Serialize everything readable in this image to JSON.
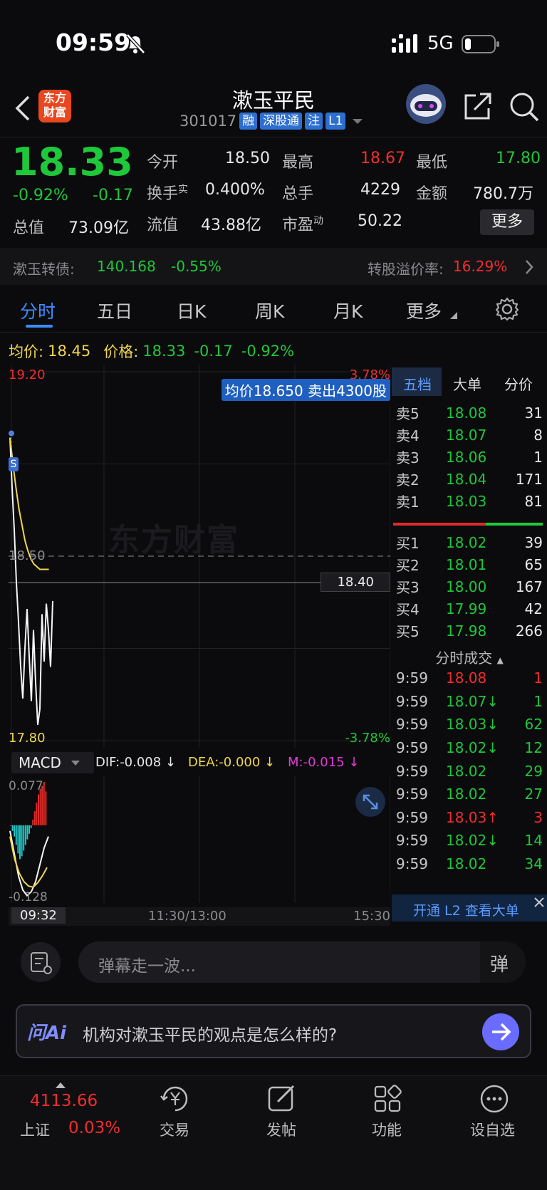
{
  "status_bar": {
    "time": "09:59",
    "network": "5G"
  },
  "header": {
    "title": "漱玉平民",
    "code": "301017",
    "badges": [
      "融",
      "深股通",
      "注",
      "L1"
    ],
    "logo_text": "东方\n财富"
  },
  "quote": {
    "price": "18.33",
    "change_pct": "-0.92%",
    "change": "-0.17",
    "open_label": "今开",
    "open": "18.50",
    "high_label": "最高",
    "high": "18.67",
    "low_label": "最低",
    "low": "17.80",
    "turnover_label": "换手",
    "turnover_sup": "实",
    "turnover": "0.400%",
    "volume_label": "总手",
    "volume": "4229",
    "amount_label": "金额",
    "amount": "780.7万",
    "mktcap_label": "总值",
    "mktcap": "73.09亿",
    "float_label": "流值",
    "float": "43.88亿",
    "pe_label": "市盈",
    "pe_sup": "动",
    "pe": "50.22",
    "more_button": "更多"
  },
  "bond": {
    "label": "漱玉转债:",
    "price": "140.168",
    "change": "-0.55%",
    "premium_label": "转股溢价率:",
    "premium": "16.29%"
  },
  "tabs": [
    "分时",
    "五日",
    "日K",
    "周K",
    "月K",
    "更多"
  ],
  "chart_info": {
    "avg_label": "均价:",
    "avg": "18.45",
    "price_label": "价格:",
    "price": "18.33",
    "change": "-0.17",
    "pct": "-0.92%"
  },
  "chart_data": {
    "type": "line",
    "y_top": "19.20",
    "y_mid": "18.50",
    "y_bottom": "17.80",
    "pct_top": "3.78%",
    "pct_bottom": "-3.78%",
    "ylim": [
      17.8,
      19.2
    ],
    "price_series": [
      18.95,
      18.76,
      18.6,
      18.4,
      18.25,
      18.08,
      17.96,
      18.15,
      18.3,
      18.12,
      17.95,
      18.22,
      18.02,
      17.86,
      17.92,
      18.28,
      18.1,
      18.32,
      18.22,
      18.08,
      18.33
    ],
    "avg_series": [
      18.95,
      18.85,
      18.76,
      18.68,
      18.62,
      18.56,
      18.52,
      18.49,
      18.47,
      18.46,
      18.45,
      18.45,
      18.45,
      18.45
    ],
    "crosshair_value": "18.40",
    "tooltip": "均价18.650 卖出4300股",
    "x_labels": [
      "09:32",
      "11:30/13:00",
      "15:30"
    ],
    "macd": {
      "label": "MACD",
      "dif": "DIF:-0.008 ↓",
      "dea": "DEA:-0.000 ↓",
      "m": "M:-0.015 ↓",
      "top": "0.077",
      "bottom": "-0.128",
      "ylim": [
        -0.128,
        0.077
      ],
      "bars": [
        0.0,
        -0.01,
        -0.02,
        -0.035,
        -0.05,
        -0.06,
        -0.055,
        -0.045,
        -0.035,
        -0.025,
        -0.015,
        -0.005,
        0.01,
        0.025,
        0.04,
        0.055,
        0.065,
        0.07,
        0.077,
        0.06
      ],
      "dif_series": [
        -0.01,
        -0.05,
        -0.09,
        -0.115,
        -0.125,
        -0.118,
        -0.1,
        -0.07,
        -0.04,
        -0.02
      ],
      "dea_series": [
        -0.02,
        -0.06,
        -0.085,
        -0.1,
        -0.108,
        -0.11,
        -0.102,
        -0.09,
        -0.075
      ]
    }
  },
  "orderbook": {
    "tabs": [
      "五档",
      "大单",
      "分价"
    ],
    "asks": [
      {
        "label": "卖5",
        "price": "18.08",
        "vol": "31"
      },
      {
        "label": "卖4",
        "price": "18.07",
        "vol": "8"
      },
      {
        "label": "卖3",
        "price": "18.06",
        "vol": "1"
      },
      {
        "label": "卖2",
        "price": "18.04",
        "vol": "171"
      },
      {
        "label": "卖1",
        "price": "18.03",
        "vol": "81"
      }
    ],
    "bids": [
      {
        "label": "买1",
        "price": "18.02",
        "vol": "39"
      },
      {
        "label": "买2",
        "price": "18.01",
        "vol": "65"
      },
      {
        "label": "买3",
        "price": "18.00",
        "vol": "167"
      },
      {
        "label": "买4",
        "price": "17.99",
        "vol": "42"
      },
      {
        "label": "买5",
        "price": "17.98",
        "vol": "266"
      }
    ],
    "trades_title": "分时成交",
    "trades": [
      {
        "time": "9:59",
        "price": "18.08",
        "vol": "1",
        "color": "red"
      },
      {
        "time": "9:59",
        "price": "18.07↓",
        "vol": "1",
        "color": "green"
      },
      {
        "time": "9:59",
        "price": "18.03↓",
        "vol": "62",
        "color": "green"
      },
      {
        "time": "9:59",
        "price": "18.02↓",
        "vol": "12",
        "color": "green"
      },
      {
        "time": "9:59",
        "price": "18.02",
        "vol": "29",
        "color": "green"
      },
      {
        "time": "9:59",
        "price": "18.02",
        "vol": "27",
        "color": "green"
      },
      {
        "time": "9:59",
        "price": "18.03↑",
        "vol": "3",
        "color": "red"
      },
      {
        "time": "9:59",
        "price": "18.02↓",
        "vol": "14",
        "color": "green"
      },
      {
        "time": "9:59",
        "price": "18.02",
        "vol": "34",
        "color": "green"
      }
    ],
    "l2_banner": "开通 L2 查看大单"
  },
  "comment": {
    "placeholder": "弹幕走一波...",
    "danmu": "弹"
  },
  "ai": {
    "logo": "问Ai",
    "prompt": "机构对漱玉平民的观点是怎么样的?"
  },
  "bottom_nav": {
    "index_value": "4113.66",
    "index_name": "上证",
    "index_change": "0.03%",
    "items": [
      "交易",
      "发帖",
      "功能",
      "设自选"
    ]
  }
}
